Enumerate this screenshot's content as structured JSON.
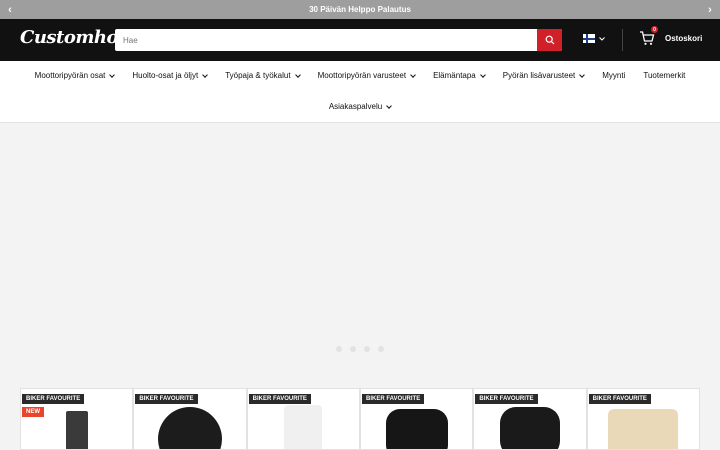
{
  "announcement": {
    "text": "30 Päivän Helppo Palautus"
  },
  "header": {
    "logo": "Customhoj",
    "search_placeholder": "Hae",
    "cart_label": "Ostoskori",
    "cart_count": "0"
  },
  "nav": {
    "row1": [
      {
        "label": "Moottoripyörän osat",
        "dropdown": true
      },
      {
        "label": "Huolto-osat ja öljyt",
        "dropdown": true
      },
      {
        "label": "Työpaja & työkalut",
        "dropdown": true
      },
      {
        "label": "Moottoripyörän varusteet",
        "dropdown": true
      },
      {
        "label": "Elämäntapa",
        "dropdown": true
      },
      {
        "label": "Pyörän lisävarusteet",
        "dropdown": true
      },
      {
        "label": "Myynti",
        "dropdown": false
      },
      {
        "label": "Tuotemerkit",
        "dropdown": false
      }
    ],
    "row2": [
      {
        "label": "Asiakaspalvelu",
        "dropdown": true
      }
    ]
  },
  "products": [
    {
      "badge": "BIKER FAVOURITE",
      "new_badge": "NEW"
    },
    {
      "badge": "BIKER FAVOURITE"
    },
    {
      "badge": "BIKER FAVOURITE"
    },
    {
      "badge": "BIKER FAVOURITE"
    },
    {
      "badge": "BIKER FAVOURITE"
    },
    {
      "badge": "BIKER FAVOURITE"
    }
  ],
  "colors": {
    "accent": "#d0202a",
    "header_bg": "#111111",
    "announce_bg": "#9e9e9e"
  }
}
